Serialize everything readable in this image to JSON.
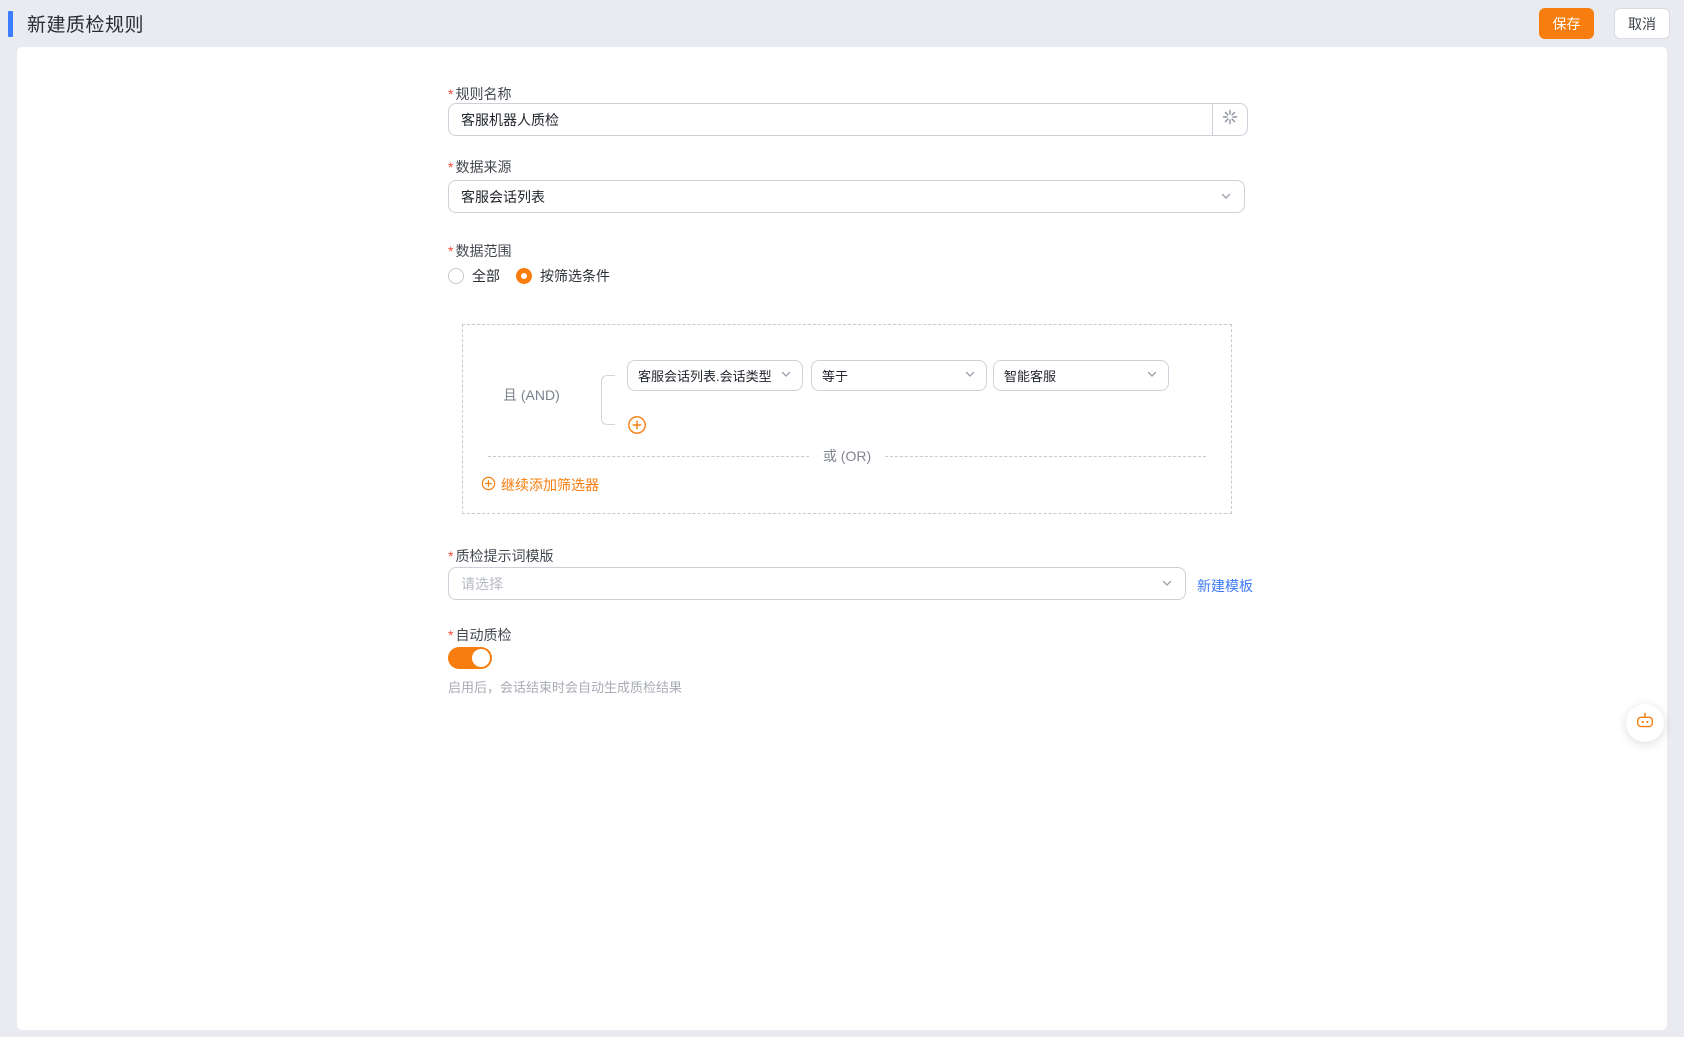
{
  "window": {
    "title": "新建质检规则"
  },
  "actions": {
    "save": "保存",
    "cancel": "取消"
  },
  "required_marker": "*",
  "form": {
    "rule_name": {
      "label": "规则名称",
      "value": "客服机器人质检"
    },
    "data_source": {
      "label": "数据来源",
      "value": "客服会话列表"
    },
    "data_range": {
      "label": "数据范围",
      "options": [
        {
          "label": "全部",
          "selected": false
        },
        {
          "label": "按筛选条件",
          "selected": true
        }
      ]
    },
    "filter_builder": {
      "group_operator": "且 (AND)",
      "or_divider": "或 (OR)",
      "condition": {
        "field": "客服会话列表.会话类型",
        "operator": "等于",
        "value": "智能客服"
      },
      "add_filter": "继续添加筛选器"
    },
    "prompt_template": {
      "label": "质检提示词模版",
      "placeholder": "请选择",
      "new_template_link": "新建模板"
    },
    "auto_qc": {
      "label": "自动质检",
      "state": "on",
      "hint": "启用后，会话结束时会自动生成质检结果"
    }
  },
  "colors": {
    "accent_orange": "#f77d0e",
    "accent_bar_blue": "#3c7dff",
    "link_blue": "#3e7bfa",
    "required_red": "#f5493c",
    "page_background": "#e9ebf1"
  },
  "icons": [
    "loading-spinner-icon",
    "chevron-down-icon",
    "plus-circle-icon",
    "robot-icon"
  ]
}
